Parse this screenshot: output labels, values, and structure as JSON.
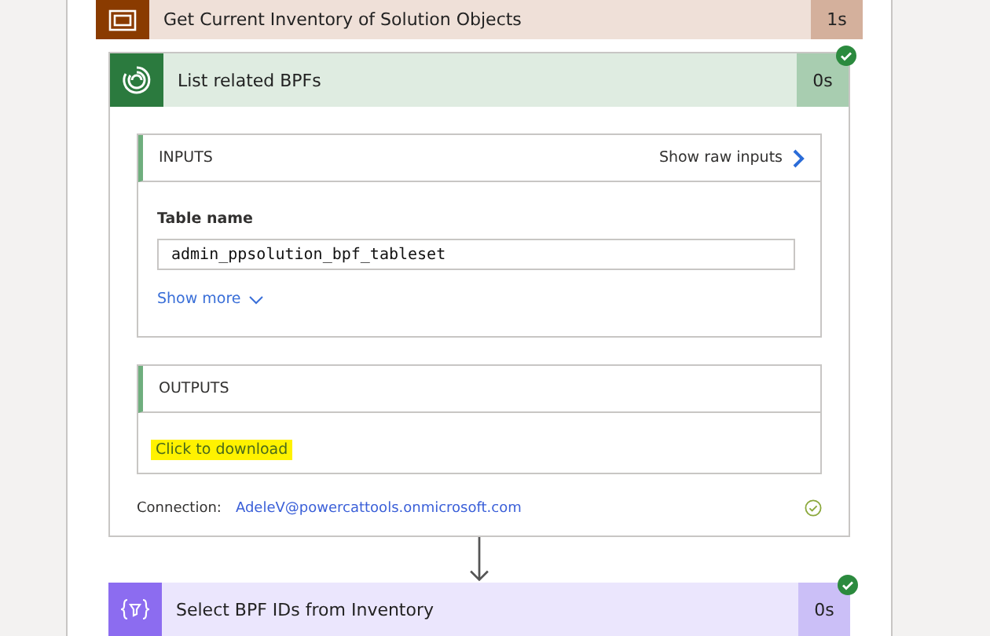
{
  "scope": {
    "kind": "scope",
    "title": "Get Current Inventory of Solution Objects",
    "duration": "1s"
  },
  "action": {
    "kind": "dataverse",
    "title": "List related BPFs",
    "duration": "0s",
    "succeeded": true,
    "inputs": {
      "heading": "INPUTS",
      "raw_link": "Show raw inputs",
      "field_label": "Table name",
      "field_value": "admin_ppsolution_bpf_tableset",
      "show_more": "Show more"
    },
    "outputs": {
      "heading": "OUTPUTS",
      "download_link": "Click to download",
      "highlighted": true
    },
    "connection": {
      "label": "Connection:",
      "account": "AdeleV@powercattools.onmicrosoft.com",
      "verified": true
    }
  },
  "next_action": {
    "kind": "select",
    "title": "Select BPF IDs from Inventory",
    "duration": "0s",
    "succeeded": true
  }
}
